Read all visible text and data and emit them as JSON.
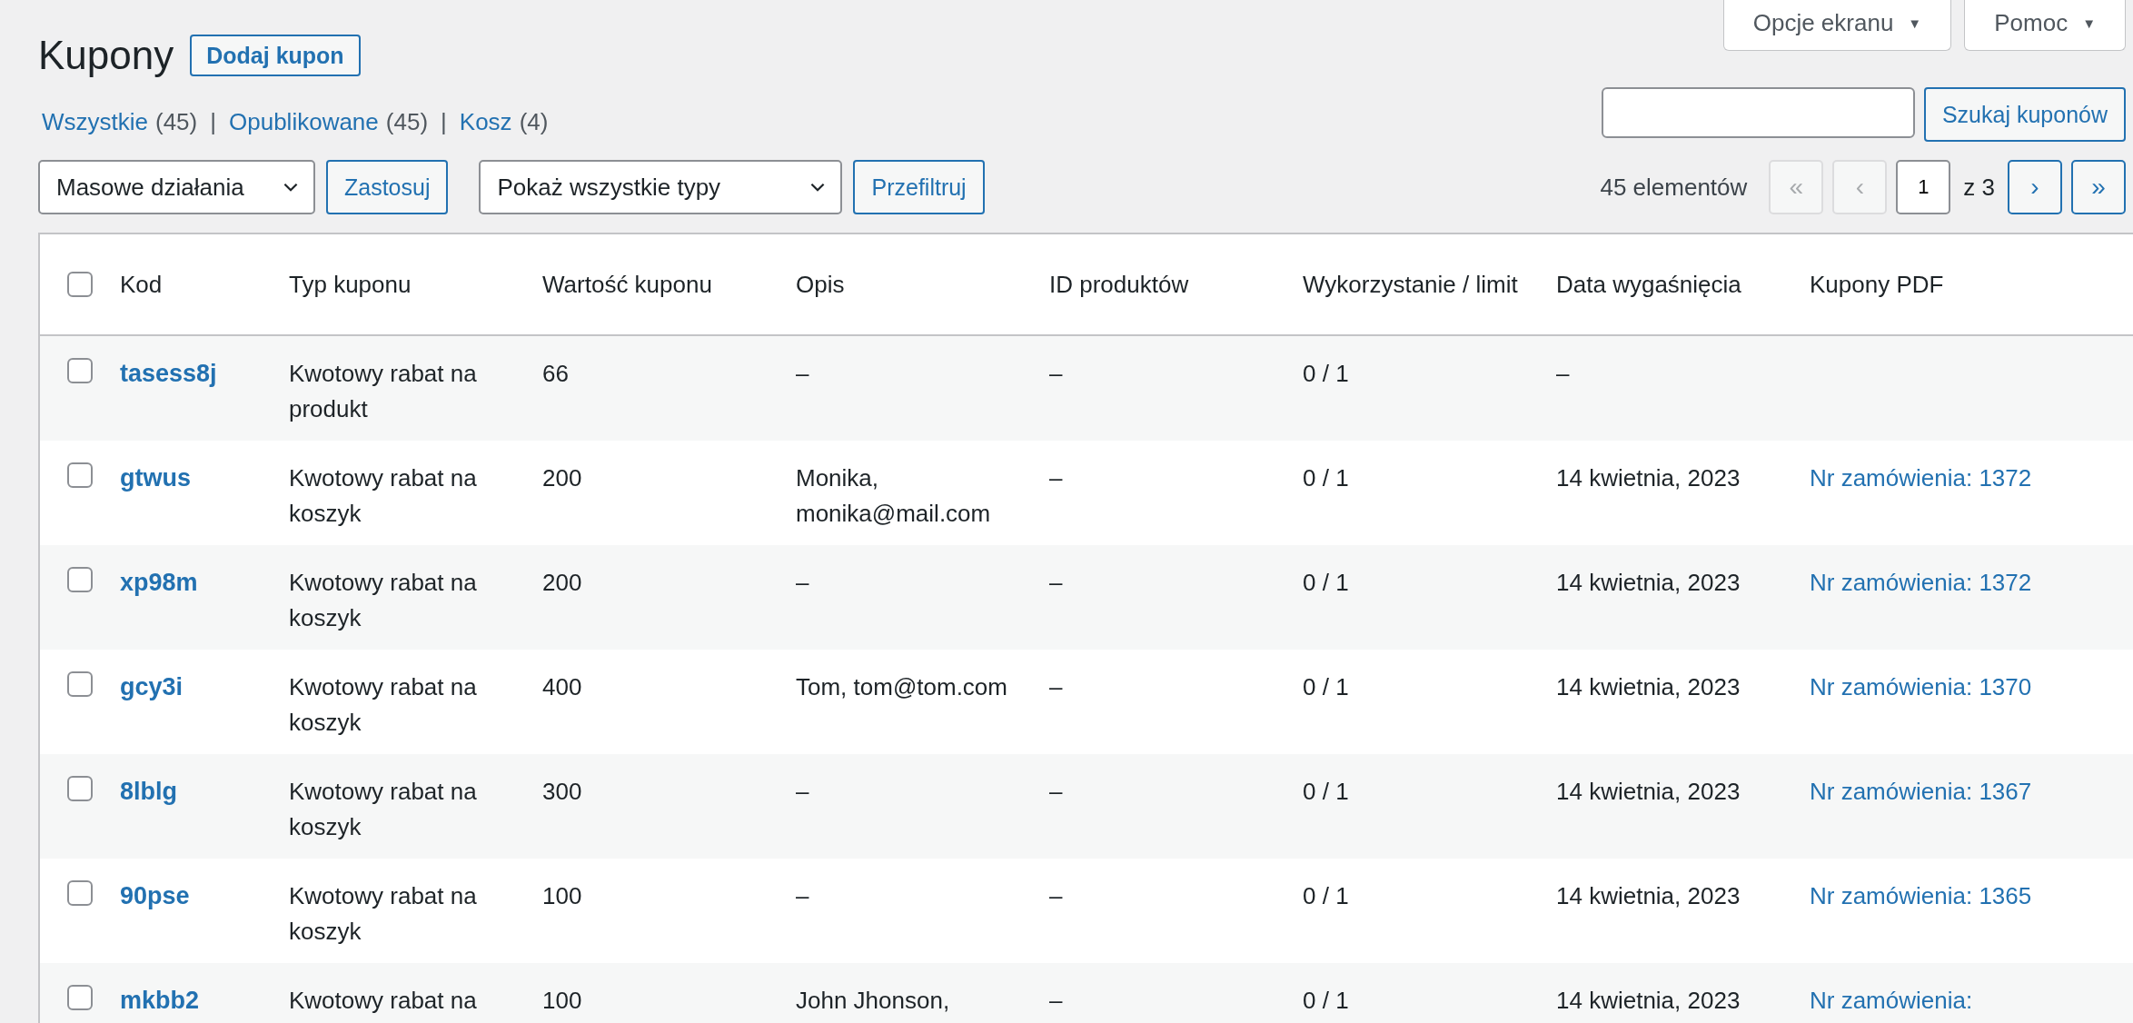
{
  "screen_meta": [
    {
      "label": "Opcje ekranu",
      "caret": "▼"
    },
    {
      "label": "Pomoc",
      "caret": "▼"
    }
  ],
  "title": "Kupony",
  "add_button": "Dodaj kupon",
  "views": [
    {
      "label": "Wszystkie",
      "count": "(45)",
      "selected": false
    },
    {
      "label": "Opublikowane",
      "count": "(45)",
      "selected": false
    },
    {
      "label": "Kosz",
      "count": "(4)",
      "selected": false
    }
  ],
  "view_separator": "|",
  "search": {
    "button": "Szukaj kuponów"
  },
  "bulk_action": {
    "value": "Masowe działania",
    "button": "Zastosuj"
  },
  "type_filter": {
    "value": "Pokaż wszystkie typy",
    "button": "Przefiltruj"
  },
  "pagination": {
    "count": "45 elementów",
    "first": "«",
    "prev": "‹",
    "page": "1",
    "of": "z 3",
    "next": "›",
    "last": "»",
    "first_disabled": true,
    "prev_disabled": true
  },
  "table": {
    "select_all_checked": false,
    "columns": [
      "Kod",
      "Typ kuponu",
      "Wartość kuponu",
      "Opis",
      "ID produktów",
      "Wykorzystanie / limit",
      "Data wygaśnięcia",
      "Kupony PDF"
    ],
    "rows": [
      {
        "checked": false,
        "code": "tasess8j",
        "type": "Kwotowy rabat na produkt",
        "value": "66",
        "description": "–",
        "product_ids": "–",
        "usage": "0 / 1",
        "expiry": "–",
        "pdf": ""
      },
      {
        "checked": false,
        "code": "gtwus",
        "type": "Kwotowy rabat na koszyk",
        "value": "200",
        "description": "Monika, monika@mail.com",
        "product_ids": "–",
        "usage": "0 / 1",
        "expiry": "14 kwietnia, 2023",
        "pdf": "Nr zamówienia: 1372"
      },
      {
        "checked": false,
        "code": "xp98m",
        "type": "Kwotowy rabat na koszyk",
        "value": "200",
        "description": "–",
        "product_ids": "–",
        "usage": "0 / 1",
        "expiry": "14 kwietnia, 2023",
        "pdf": "Nr zamówienia: 1372"
      },
      {
        "checked": false,
        "code": "gcy3i",
        "type": "Kwotowy rabat na koszyk",
        "value": "400",
        "description": "Tom, tom@tom.com",
        "product_ids": "–",
        "usage": "0 / 1",
        "expiry": "14 kwietnia, 2023",
        "pdf": "Nr zamówienia: 1370"
      },
      {
        "checked": false,
        "code": "8lblg",
        "type": "Kwotowy rabat na koszyk",
        "value": "300",
        "description": "–",
        "product_ids": "–",
        "usage": "0 / 1",
        "expiry": "14 kwietnia, 2023",
        "pdf": "Nr zamówienia: 1367"
      },
      {
        "checked": false,
        "code": "90pse",
        "type": "Kwotowy rabat na koszyk",
        "value": "100",
        "description": "–",
        "product_ids": "–",
        "usage": "0 / 1",
        "expiry": "14 kwietnia, 2023",
        "pdf": "Nr zamówienia: 1365"
      },
      {
        "checked": false,
        "code": "mkbb2",
        "type": "Kwotowy rabat na",
        "value": "100",
        "description": "John Jhonson,",
        "product_ids": "–",
        "usage": "0 / 1",
        "expiry": "14 kwietnia, 2023",
        "pdf": "Nr zamówienia:"
      }
    ]
  }
}
